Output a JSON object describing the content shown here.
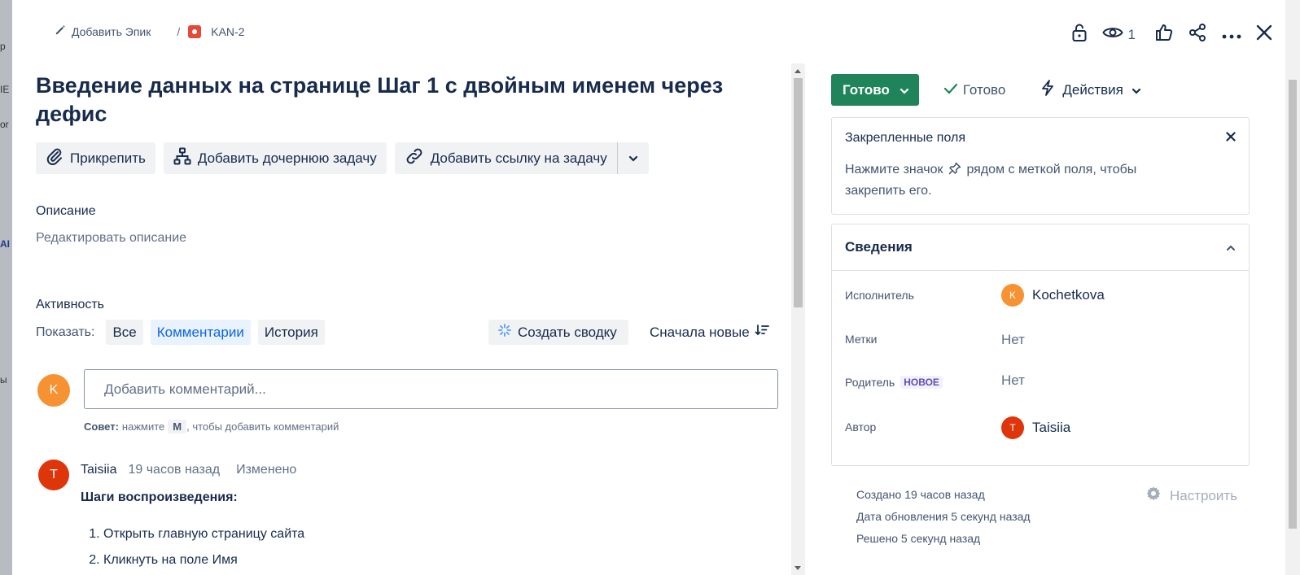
{
  "backdrop": {
    "fragments": [
      "р",
      "IE",
      "or",
      "AI",
      "ы"
    ]
  },
  "breadcrumb": {
    "epic_label": "Добавить Эпик",
    "separator": "/",
    "issue_key": "KAN-2"
  },
  "top_actions": {
    "watchers_count": "1"
  },
  "issue": {
    "title": "Введение данных на странице Шаг 1 с двойным именем через дефис",
    "buttons": {
      "attach": "Прикрепить",
      "add_child": "Добавить дочернюю задачу",
      "link_issue": "Добавить ссылку на задачу"
    },
    "description": {
      "heading": "Описание",
      "placeholder": "Редактировать описание"
    }
  },
  "activity": {
    "heading": "Активность",
    "show_label": "Показать:",
    "filters": [
      "Все",
      "Комментарии",
      "История"
    ],
    "active_filter": "Комментарии",
    "summary_button": "Создать сводку",
    "sort_label": "Сначала новые",
    "current_user_initial": "K",
    "comment_placeholder": "Добавить комментарий...",
    "tip_prefix": "Совет:",
    "tip_press": "нажмите",
    "tip_key": "M",
    "tip_suffix": ", чтобы добавить комментарий"
  },
  "comments": [
    {
      "author": "Taisiia",
      "initial": "T",
      "time": "19 часов назад",
      "edited": "Изменено",
      "heading": "Шаги воспроизведения:",
      "steps": [
        "Открыть главную страницу сайта",
        "Кликнуть на поле Имя"
      ]
    }
  ],
  "status": {
    "current": "Готово",
    "resolution": "Готово",
    "actions_label": "Действия"
  },
  "pinned_fields": {
    "heading": "Закрепленные поля",
    "hint_before": "Нажмите значок",
    "hint_after": "рядом с меткой поля, чтобы закрепить его."
  },
  "details": {
    "heading": "Сведения",
    "assignee_label": "Исполнитель",
    "assignee_name": "Kochetkova",
    "assignee_initial": "K",
    "labels_label": "Метки",
    "labels_value": "Нет",
    "parent_label": "Родитель",
    "parent_badge": "НОВОЕ",
    "parent_value": "Нет",
    "reporter_label": "Автор",
    "reporter_name": "Taisiia",
    "reporter_initial": "T"
  },
  "meta": {
    "created": "Создано 19 часов назад",
    "updated": "Дата обновления 5 секунд назад",
    "resolved": "Решено 5 секунд назад",
    "configure": "Настроить"
  },
  "colors": {
    "status_green": "#1f845a",
    "avatar_k": "#f79232",
    "avatar_t": "#de350b",
    "link_blue": "#0c66e4",
    "bug_red": "#e5493a"
  }
}
